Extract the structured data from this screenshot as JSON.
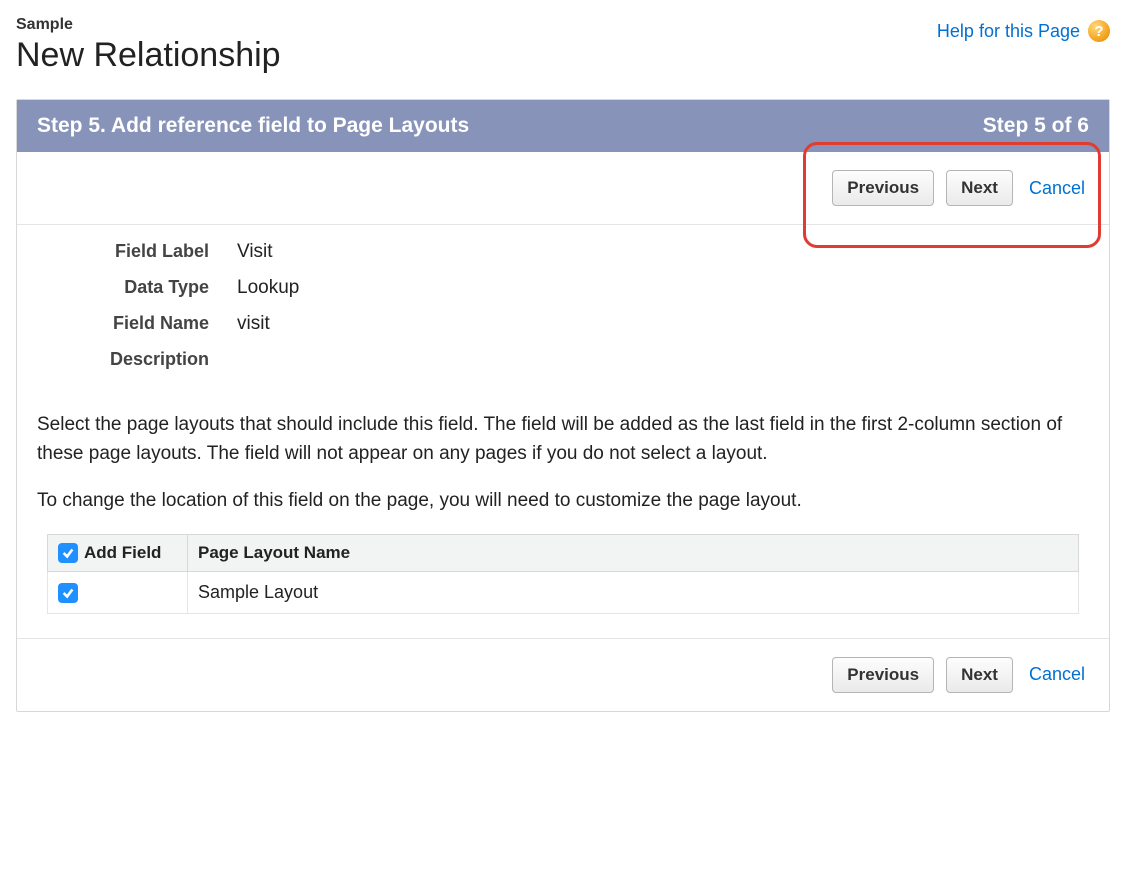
{
  "header": {
    "breadcrumb": "Sample",
    "title": "New Relationship",
    "help_label": "Help for this Page"
  },
  "step": {
    "title": "Step 5. Add reference field to Page Layouts",
    "counter": "Step 5 of 6"
  },
  "buttons": {
    "previous": "Previous",
    "next": "Next",
    "cancel": "Cancel"
  },
  "fields": {
    "field_label_label": "Field Label",
    "field_label_value": "Visit",
    "data_type_label": "Data Type",
    "data_type_value": "Lookup",
    "field_name_label": "Field Name",
    "field_name_value": "visit",
    "description_label": "Description",
    "description_value": ""
  },
  "instructions": {
    "para1": "Select the page layouts that should include this field. The field will be added as the last field in the first 2-column section of these page layouts. The field will not appear on any pages if you do not select a layout.",
    "para2": "To change the location of this field on the page, you will need to customize the page layout."
  },
  "table": {
    "col_add": "Add Field",
    "col_name": "Page Layout Name",
    "rows": [
      {
        "name": "Sample Layout",
        "checked": true
      }
    ]
  }
}
